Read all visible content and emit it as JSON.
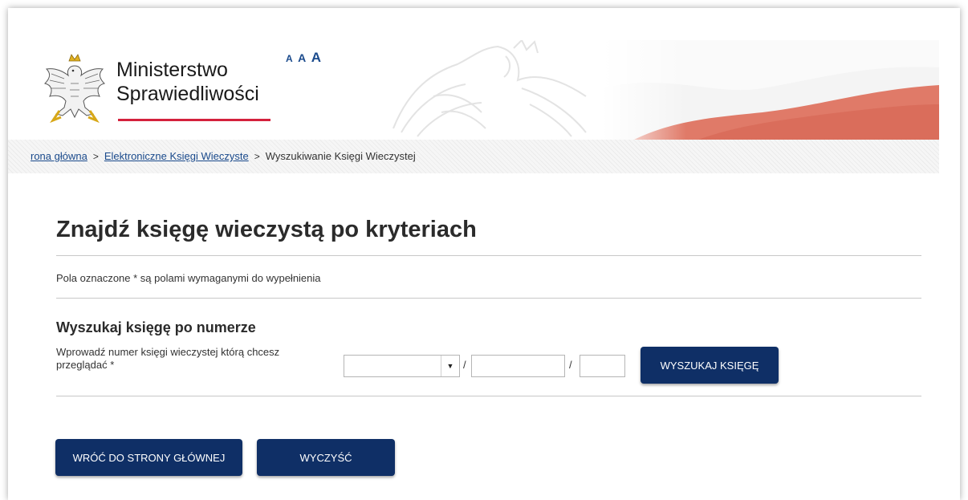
{
  "header": {
    "brand_line1": "Ministerstwo",
    "brand_line2": "Sprawiedliwości",
    "font_size_options": [
      "A",
      "A",
      "A"
    ],
    "colors": {
      "brand_red": "#d4213d",
      "link_blue": "#1a4a8c",
      "button_navy": "#0f2f66"
    }
  },
  "breadcrumb": {
    "home": "rona główna",
    "section": "Elektroniczne Księgi Wieczyste",
    "current": "Wyszukiwanie Księgi Wieczystej",
    "separator": ">"
  },
  "main": {
    "title": "Znajdź księgę wieczystą po kryteriach",
    "required_note": "Pola oznaczone * są polami wymaganymi do wypełnienia",
    "section_title": "Wyszukaj księgę po numerze",
    "field_label": "Wprowadź numer księgi wieczystej którą chcesz przeglądać *",
    "court_code": {
      "value": "",
      "arrow": "▼"
    },
    "slash": "/",
    "book_number": {
      "value": ""
    },
    "check_digit": {
      "value": ""
    },
    "search_button": "WYSZUKAJ KSIĘGĘ",
    "back_button": "WRÓĆ DO STRONY GŁÓWNEJ",
    "clear_button": "WYCZYŚĆ"
  }
}
